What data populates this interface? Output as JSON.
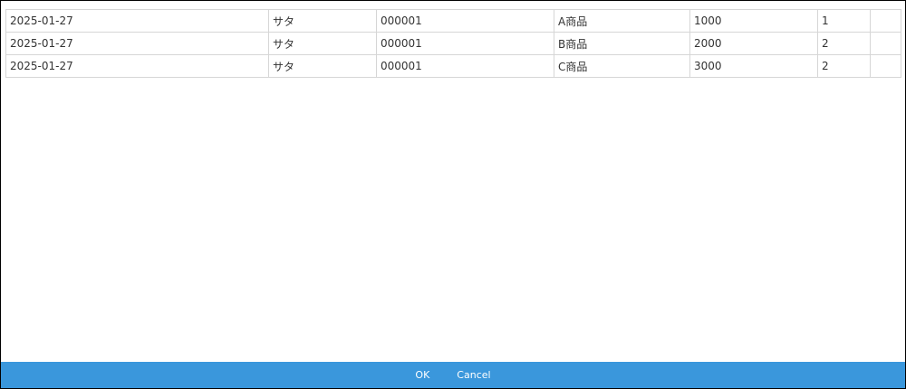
{
  "header": {
    "remnant_text": "..."
  },
  "table": {
    "rows": [
      [
        "2025-01-27",
        "サタ",
        "000001",
        "A商品",
        "1000",
        "1",
        ""
      ],
      [
        "2025-01-27",
        "サタ",
        "000001",
        "B商品",
        "2000",
        "2",
        ""
      ],
      [
        "2025-01-27",
        "サタ",
        "000001",
        "C商品",
        "3000",
        "2",
        ""
      ]
    ]
  },
  "footer": {
    "ok_label": "OK",
    "cancel_label": "Cancel"
  },
  "colors": {
    "footer_bar": "#3a97dc",
    "grid_border": "#d6d6d6",
    "text": "#333333"
  }
}
